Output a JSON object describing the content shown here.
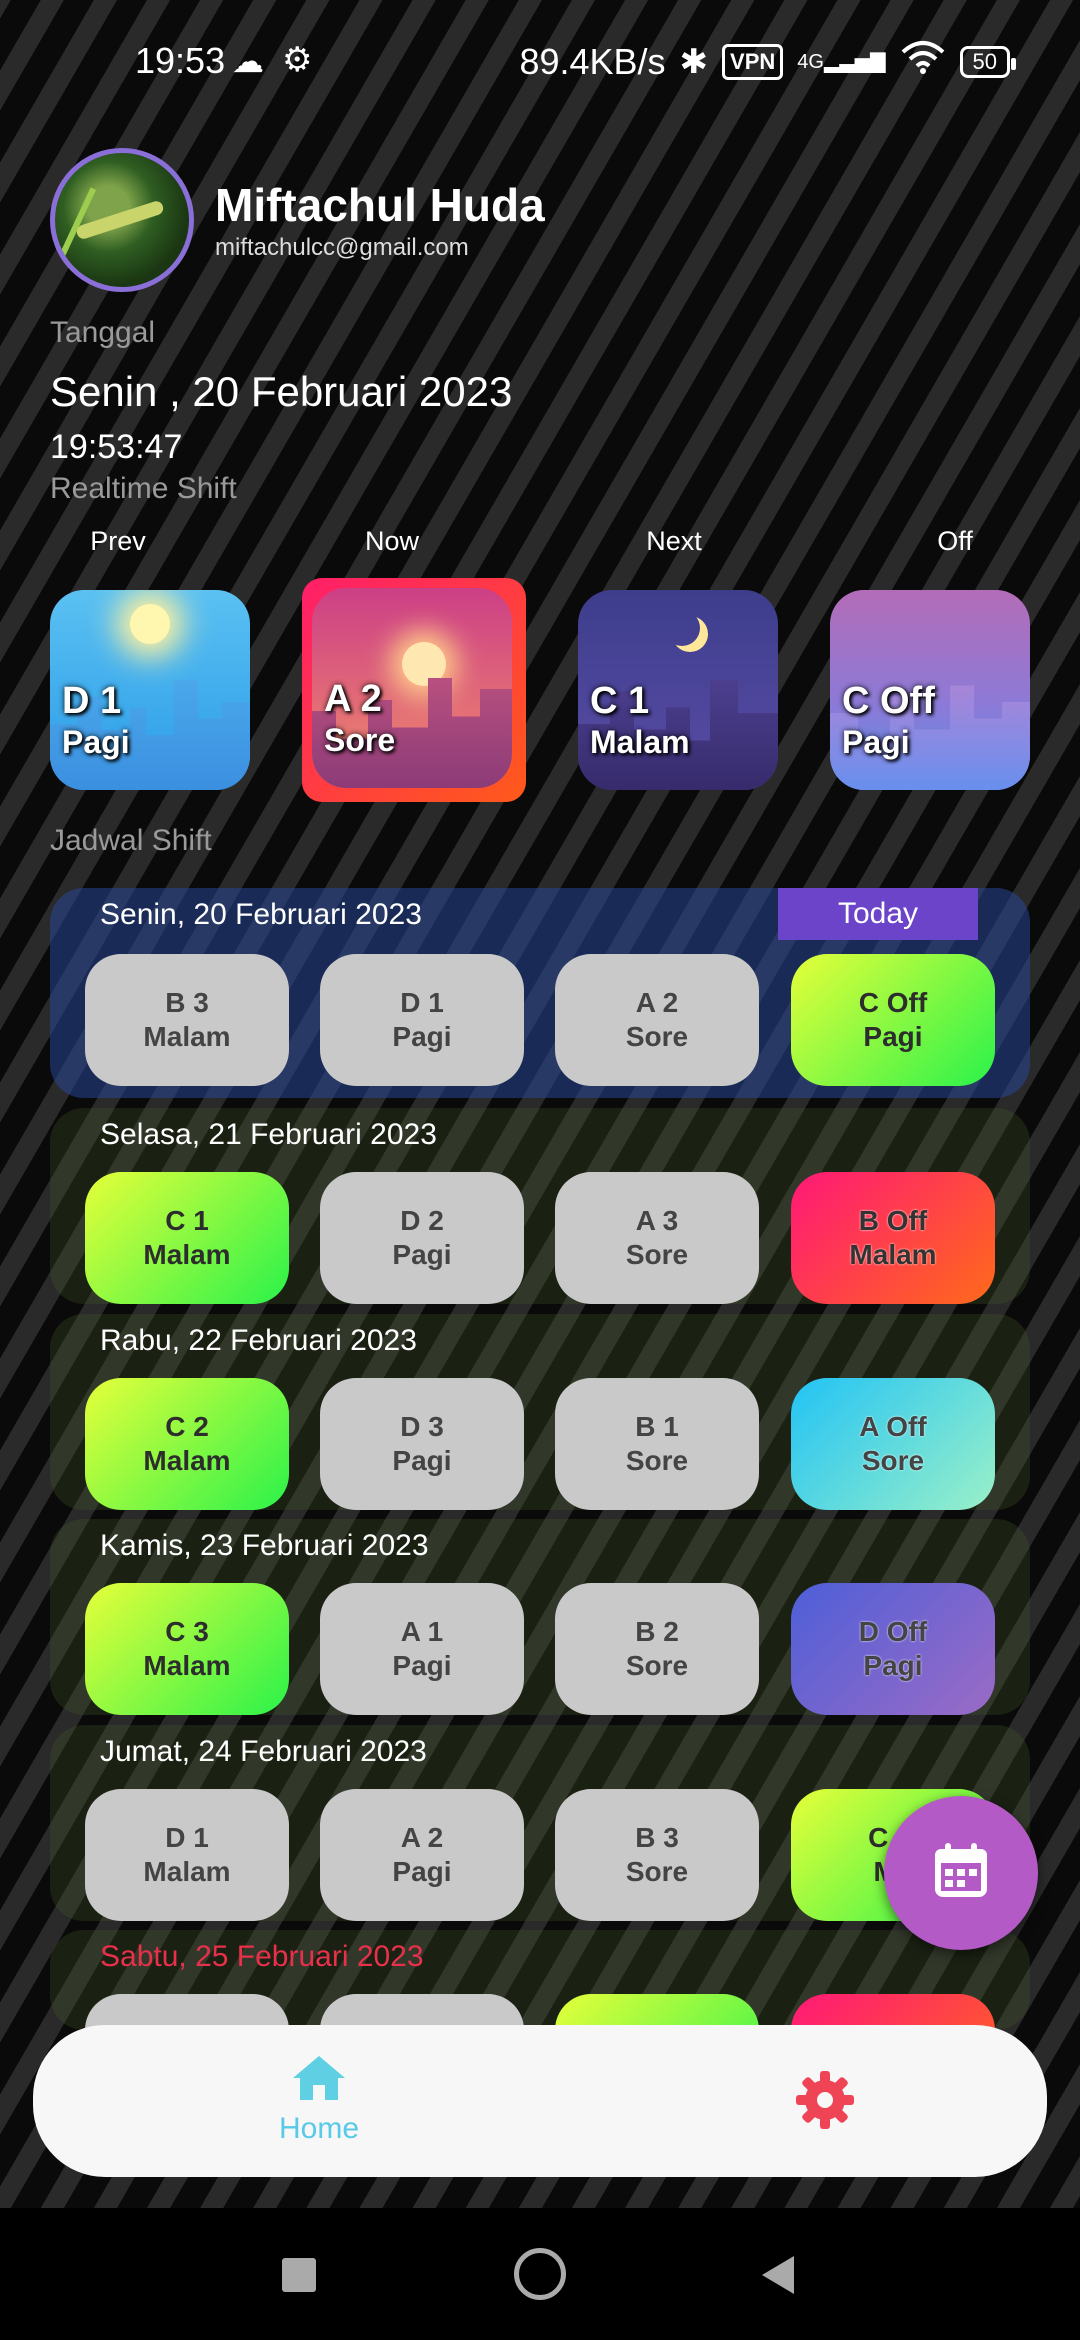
{
  "status_bar": {
    "time": "19:53",
    "net_speed": "89.4KB/s",
    "vpn": "VPN",
    "network": "4G",
    "battery": "50"
  },
  "profile": {
    "name": "Miftachul Huda",
    "email": "miftachulcc@gmail.com"
  },
  "tanggal_label": "Tanggal",
  "date": "Senin , 20 Februari 2023",
  "clock": "19:53:47",
  "realtime_label": "Realtime Shift",
  "realtime": [
    {
      "header": "Prev",
      "line1": "D 1",
      "line2": "Pagi"
    },
    {
      "header": "Now",
      "line1": "A 2",
      "line2": "Sore"
    },
    {
      "header": "Next",
      "line1": "C 1",
      "line2": "Malam"
    },
    {
      "header": "Off",
      "line1": "C Off",
      "line2": "Pagi"
    }
  ],
  "jadwal_label": "Jadwal Shift",
  "today_badge": "Today",
  "schedule": [
    {
      "day": "Senin, 20 Februari 2023",
      "shifts": [
        {
          "a": "B  3",
          "b": "Malam"
        },
        {
          "a": "D  1",
          "b": "Pagi"
        },
        {
          "a": "A  2",
          "b": "Sore"
        },
        {
          "a": "C  Off",
          "b": "Pagi"
        }
      ]
    },
    {
      "day": "Selasa, 21 Februari 2023",
      "shifts": [
        {
          "a": "C  1",
          "b": "Malam"
        },
        {
          "a": "D  2",
          "b": "Pagi"
        },
        {
          "a": "A  3",
          "b": "Sore"
        },
        {
          "a": "B  Off",
          "b": "Malam"
        }
      ]
    },
    {
      "day": "Rabu, 22 Februari 2023",
      "shifts": [
        {
          "a": "C  2",
          "b": "Malam"
        },
        {
          "a": "D  3",
          "b": "Pagi"
        },
        {
          "a": "B  1",
          "b": "Sore"
        },
        {
          "a": "A  Off",
          "b": "Sore"
        }
      ]
    },
    {
      "day": "Kamis, 23 Februari 2023",
      "shifts": [
        {
          "a": "C  3",
          "b": "Malam"
        },
        {
          "a": "A  1",
          "b": "Pagi"
        },
        {
          "a": "B  2",
          "b": "Sore"
        },
        {
          "a": "D  Off",
          "b": "Pagi"
        }
      ]
    },
    {
      "day": "Jumat, 24 Februari 2023",
      "shifts": [
        {
          "a": "D  1",
          "b": "Malam"
        },
        {
          "a": "A  2",
          "b": "Pagi"
        },
        {
          "a": "B  3",
          "b": "Sore"
        },
        {
          "a": "C  O",
          "b": "Ma"
        }
      ]
    },
    {
      "day": "Sabtu, 25 Februari 2023"
    }
  ],
  "nav": {
    "home_label": "Home",
    "home_icon": "house-icon",
    "settings_icon": "gear-icon"
  },
  "colors": {
    "accent_today": "#6b44c9",
    "home_active": "#58c9e6",
    "settings": "#ee4455",
    "fab": "#b45ac6",
    "weekend_day": "#e8304a"
  }
}
